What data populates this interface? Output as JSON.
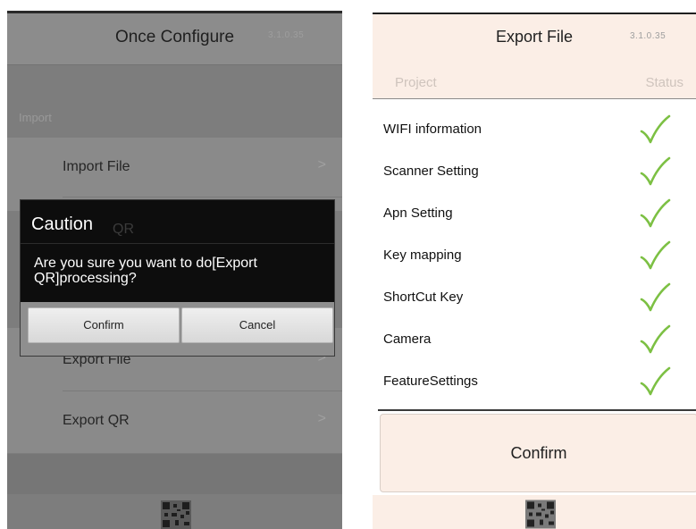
{
  "left_screen": {
    "title": "Once Configure",
    "version": "3.1.0.35",
    "section_label": "Import",
    "items": [
      {
        "label": "Import File",
        "chevron": ">"
      },
      {
        "label": "Export File",
        "chevron": ">"
      },
      {
        "label": "Export QR",
        "chevron": ">"
      }
    ],
    "obscured_item_fragment": "QR",
    "dialog": {
      "title": "Caution",
      "message": "Are you sure you want to do[Export QR]processing?",
      "confirm_label": "Confirm",
      "cancel_label": "Cancel"
    }
  },
  "right_screen": {
    "title": "Export File",
    "version": "3.1.0.35",
    "header": {
      "project": "Project",
      "status": "Status"
    },
    "items": [
      {
        "label": "WIFI information",
        "status": "check-icon"
      },
      {
        "label": "Scanner Setting",
        "status": "check-icon"
      },
      {
        "label": "Apn Setting",
        "status": "check-icon"
      },
      {
        "label": "Key mapping",
        "status": "check-icon"
      },
      {
        "label": "ShortCut Key",
        "status": "check-icon"
      },
      {
        "label": "Camera",
        "status": "check-icon"
      },
      {
        "label": "FeatureSettings",
        "status": "check-icon"
      }
    ],
    "confirm_label": "Confirm"
  },
  "colors": {
    "check_green": "#7cc043",
    "right_background": "#fbeee6",
    "dialog_background": "#0d0d0d",
    "overlay_gray": "#7d7d7d"
  }
}
